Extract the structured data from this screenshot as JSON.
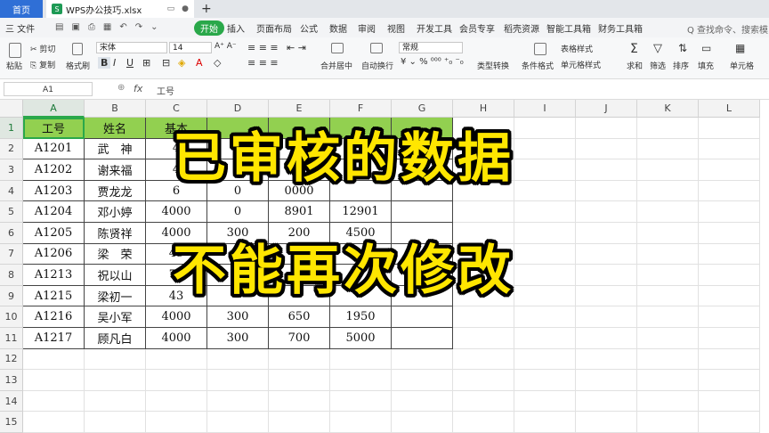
{
  "tabs": {
    "home": "首页",
    "file": "WPS办公技巧.xlsx",
    "add": "+"
  },
  "menu": {
    "file": "三 文件",
    "items": [
      "开始",
      "插入",
      "页面布局",
      "公式",
      "数据",
      "审阅",
      "视图",
      "开发工具",
      "会员专享",
      "稻壳资源",
      "智能工具箱",
      "财务工具箱"
    ],
    "active": "开始",
    "search": "Q 查找命令、搜索模板"
  },
  "ribbon": {
    "paste": "粘贴",
    "cut": "剪切",
    "copy": "复制",
    "format_painter": "格式刷",
    "font": "宋体",
    "size": "14",
    "number_format": "常规",
    "merge": "合并居中",
    "wrap": "自动换行",
    "convert": "类型转换",
    "cond_format": "条件格式",
    "table_style": "表格样式",
    "cell_style": "单元格样式",
    "sum": "求和",
    "filter": "筛选",
    "sort": "排序",
    "fill": "填充",
    "cell": "单元格",
    "bold": "B",
    "italic": "I",
    "underline": "U"
  },
  "formula_bar": {
    "name_box": "A1",
    "fx": "fx",
    "content": "工号"
  },
  "columns": [
    "A",
    "B",
    "C",
    "D",
    "E",
    "F",
    "G",
    "H",
    "I",
    "J",
    "K",
    "L"
  ],
  "rows": [
    "1",
    "2",
    "3",
    "4",
    "5",
    "6",
    "7",
    "8",
    "9",
    "10",
    "11",
    "12",
    "13",
    "14",
    "15"
  ],
  "table": {
    "headers": [
      "工号",
      "姓名",
      "基本"
    ],
    "rows": [
      [
        "A1201",
        "武　神",
        "4",
        "",
        "",
        "",
        ""
      ],
      [
        "A1202",
        "谢来福",
        "4",
        "",
        "",
        "",
        ""
      ],
      [
        "A1203",
        "贾龙龙",
        "6",
        "0",
        "0000",
        "",
        ""
      ],
      [
        "A1204",
        "邓小婷",
        "4000",
        "0",
        "8901",
        "12901",
        ""
      ],
      [
        "A1205",
        "陈贤祥",
        "4000",
        "300",
        "200",
        "4500",
        ""
      ],
      [
        "A1206",
        "梁　荣",
        "45",
        "",
        "",
        "",
        ""
      ],
      [
        "A1213",
        "祝以山",
        "78",
        "",
        "",
        "",
        ""
      ],
      [
        "A1215",
        "梁初一",
        "43",
        "",
        "",
        "",
        ""
      ],
      [
        "A1216",
        "吴小军",
        "4000",
        "300",
        "650",
        "1950",
        ""
      ],
      [
        "A1217",
        "顾凡白",
        "4000",
        "300",
        "700",
        "5000",
        ""
      ]
    ]
  },
  "overlay": {
    "line1": "已审核的数据",
    "line2": "不能再次修改"
  }
}
